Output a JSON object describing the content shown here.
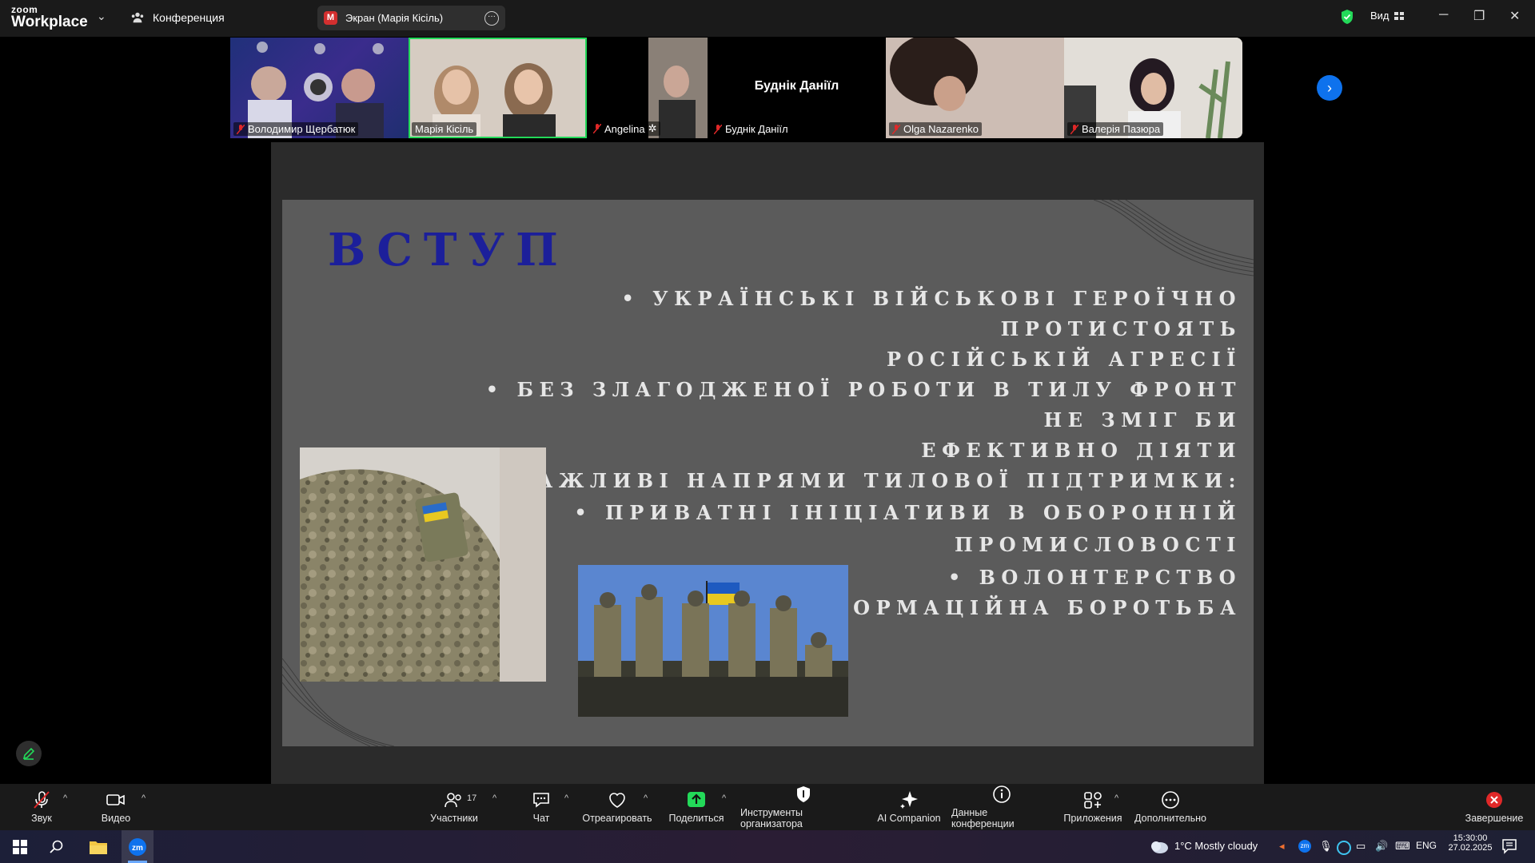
{
  "topbar": {
    "logo_line1": "zoom",
    "logo_line2": "Workplace",
    "conference_label": "Конференция",
    "share_badge": "M",
    "share_tab_label": "Экран (Марія Кісіль)",
    "view_label": "Вид"
  },
  "participants": [
    {
      "name": "Володимир Щербатюк",
      "muted": true
    },
    {
      "name": "Марія Кісіль",
      "muted": false,
      "active_speaker": true
    },
    {
      "name": "Angelina",
      "muted": true
    },
    {
      "name": "Буднік Даніїл",
      "muted": true,
      "no_video_label": "Буднік Даніїл"
    },
    {
      "name": "Olga Nazarenko",
      "muted": true
    },
    {
      "name": "Валерія Пазюра",
      "muted": true
    }
  ],
  "slide": {
    "title": "ВСТУП",
    "bullets": [
      "• УКРАЇНСЬКІ ВІЙСЬКОВІ ГЕРОЇЧНО ПРОТИСТОЯТЬ",
      "РОСІЙСЬКІЙ АГРЕСІЇ",
      "• БЕЗ ЗЛАГОДЖЕНОЇ РОБОТИ В ТИЛУ ФРОНТ НЕ ЗМІГ БИ",
      "ЕФЕКТИВНО ДІЯТИ",
      "• ВАЖЛИВІ НАПРЯМИ ТИЛОВОЇ ПІДТРИМКИ:",
      "• ПРИВАТНІ ІНІЦІАТИВИ В ОБОРОННІЙ",
      "ПРОМИСЛОВОСТІ",
      "• ВОЛОНТЕРСТВО",
      "• ІНФОРМАЦІЙНА БОРОТЬБА"
    ],
    "title_color": "#1c1f9a"
  },
  "toolbar": {
    "audio": "Звук",
    "video": "Видео",
    "participants": "Участники",
    "participants_count": "17",
    "chat": "Чат",
    "react": "Отреагировать",
    "share": "Поделиться",
    "host_tools": "Инструменты организатора",
    "ai_companion": "AI Companion",
    "meeting_info": "Данные конференции",
    "apps": "Приложения",
    "more": "Дополнительно",
    "end": "Завершение"
  },
  "taskbar": {
    "weather": "1°C  Mostly cloudy",
    "lang": "ENG",
    "time": "15:30:00",
    "date": "27.02.2025"
  },
  "colors": {
    "accent_blue": "#0e72ed",
    "active_green": "#23d959",
    "end_red": "#e02828",
    "share_green": "#23d959"
  }
}
